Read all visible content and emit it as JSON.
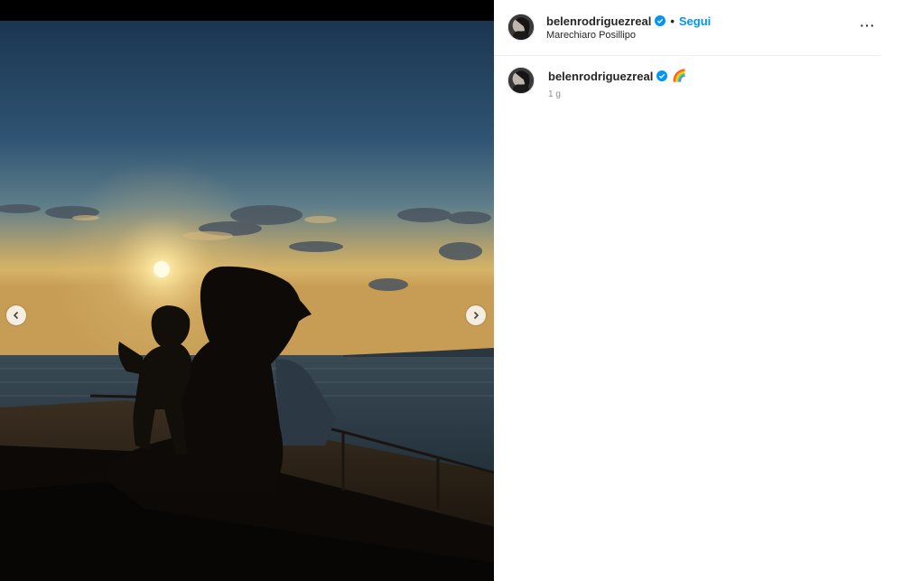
{
  "post": {
    "username": "belenrodriguezreal",
    "follow_label": "Segui",
    "separator": "•",
    "location": "Marechiaro Posillipo",
    "more_label": "···"
  },
  "caption": {
    "username": "belenrodriguezreal",
    "text": "🌈",
    "timestamp": "1 g"
  },
  "icons": {
    "verified": "verified-badge-icon",
    "prev": "chevron-left-icon",
    "next": "chevron-right-icon",
    "more": "more-options-icon"
  },
  "colors": {
    "follow": "#0095f6",
    "verified": "#0095f6",
    "timestamp": "#8e8e8e"
  }
}
